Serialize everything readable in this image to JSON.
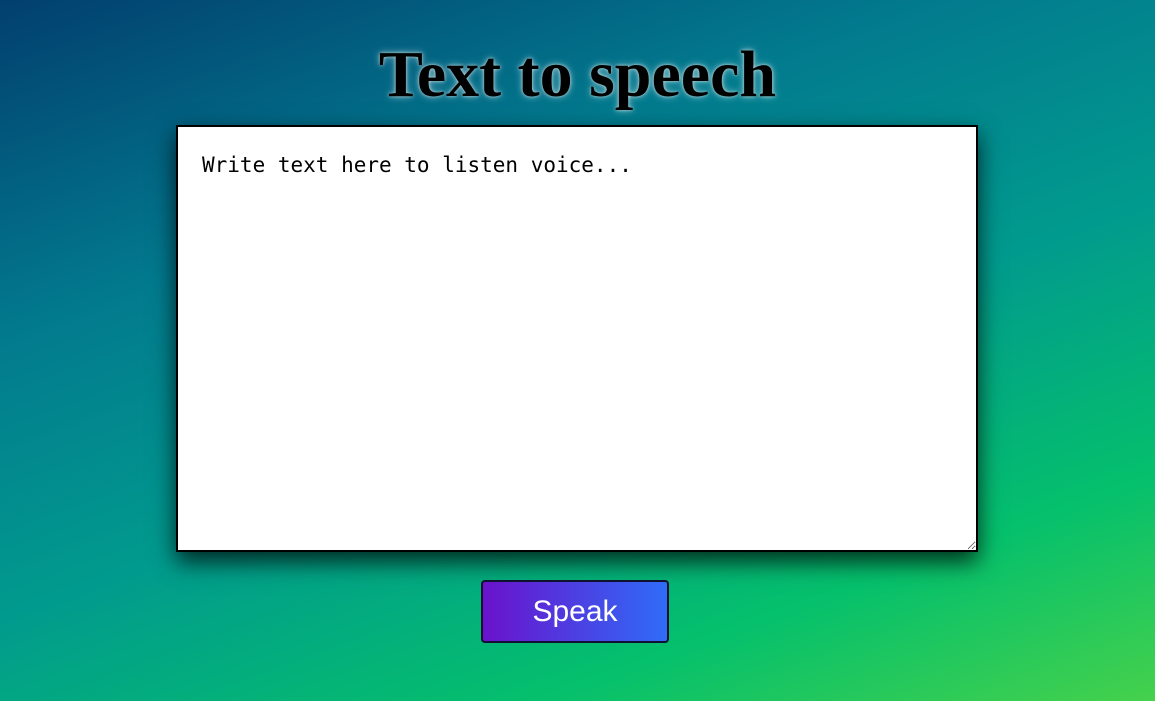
{
  "page": {
    "title": "Text to speech"
  },
  "editor": {
    "placeholder": "Write text here to listen voice...",
    "value": ""
  },
  "actions": {
    "speak_label": "Speak"
  },
  "colors": {
    "button_gradient_start": "#6a12cc",
    "button_gradient_end": "#2f6cf7",
    "background_top_left": "#023f6f",
    "background_bottom_right": "#45d14c"
  }
}
